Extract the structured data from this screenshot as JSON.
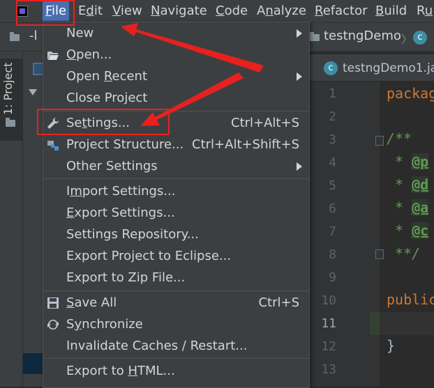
{
  "menubar": {
    "items": [
      {
        "label": "File",
        "pre": "",
        "mn": "F",
        "post": "ile",
        "active": true
      },
      {
        "label": "Edit",
        "pre": "E",
        "mn": "d",
        "post": "it"
      },
      {
        "label": "View",
        "pre": "",
        "mn": "V",
        "post": "iew"
      },
      {
        "label": "Navigate",
        "pre": "",
        "mn": "N",
        "post": "avigate"
      },
      {
        "label": "Code",
        "pre": "",
        "mn": "C",
        "post": "ode"
      },
      {
        "label": "Analyze",
        "pre": "A",
        "mn": "n",
        "post": "alyze"
      },
      {
        "label": "Refactor",
        "pre": "",
        "mn": "R",
        "post": "efactor"
      },
      {
        "label": "Build",
        "pre": "",
        "mn": "B",
        "post": "uild"
      },
      {
        "label": "Ru",
        "pre": "R",
        "mn": "u",
        "post": ""
      }
    ]
  },
  "toolbar": {
    "project_stub": "-l",
    "breadcrumb": "testngDemo",
    "breadcrumb_icon_letter": "c"
  },
  "side_panel": {
    "tab_label": "1: Project"
  },
  "editor": {
    "tab_label": "testngDemo1.ja",
    "tab_icon_letter": "c",
    "line_numbers": [
      "1",
      "2",
      "3",
      "4",
      "5",
      "6",
      "7",
      "8",
      "9",
      "10",
      "11",
      "12",
      "13"
    ],
    "current_line": "11",
    "code": {
      "l1": "packag",
      "l3": "/**",
      "l4_star": " * ",
      "l4_tag": "@p",
      "l5_star": " * ",
      "l5_tag": "@d",
      "l6_star": " * ",
      "l6_tag": "@a",
      "l7_star": " * ",
      "l7_tag": "@c",
      "l8": " **/",
      "l10": "public",
      "l12": "}"
    }
  },
  "file_menu": {
    "items": [
      {
        "key": "new",
        "pre": "New",
        "mn": "",
        "post": "",
        "shortcut": "",
        "submenu": true,
        "icon": ""
      },
      {
        "key": "open",
        "pre": "",
        "mn": "O",
        "post": "pen...",
        "shortcut": "",
        "submenu": false,
        "icon": "folder-open-icon"
      },
      {
        "key": "open_recent",
        "pre": "Open ",
        "mn": "R",
        "post": "ecent",
        "shortcut": "",
        "submenu": true,
        "icon": ""
      },
      {
        "key": "close_project",
        "pre": "Close Pro",
        "mn": "j",
        "post": "ect",
        "shortcut": "",
        "submenu": false,
        "icon": ""
      },
      {
        "key": "settings",
        "pre": "Se",
        "mn": "t",
        "post": "tings...",
        "shortcut": "Ctrl+Alt+S",
        "submenu": false,
        "icon": "wrench-icon"
      },
      {
        "key": "project_structure",
        "pre": "Project Structure...",
        "mn": "",
        "post": "",
        "shortcut": "Ctrl+Alt+Shift+S",
        "submenu": false,
        "icon": "project-structure-icon"
      },
      {
        "key": "other_settings",
        "pre": "Other Settings",
        "mn": "",
        "post": "",
        "shortcut": "",
        "submenu": true,
        "icon": ""
      },
      {
        "key": "import_settings",
        "pre": "I",
        "mn": "m",
        "post": "port Settings...",
        "shortcut": "",
        "submenu": false,
        "icon": ""
      },
      {
        "key": "export_settings",
        "pre": "",
        "mn": "E",
        "post": "xport Settings...",
        "shortcut": "",
        "submenu": false,
        "icon": ""
      },
      {
        "key": "settings_repository",
        "pre": "Settings Repository...",
        "mn": "",
        "post": "",
        "shortcut": "",
        "submenu": false,
        "icon": ""
      },
      {
        "key": "export_eclipse",
        "pre": "Export Project to Eclipse...",
        "mn": "",
        "post": "",
        "shortcut": "",
        "submenu": false,
        "icon": ""
      },
      {
        "key": "export_zip",
        "pre": "Export to Zip File...",
        "mn": "",
        "post": "",
        "shortcut": "",
        "submenu": false,
        "icon": ""
      },
      {
        "key": "save_all",
        "pre": "",
        "mn": "S",
        "post": "ave All",
        "shortcut": "Ctrl+S",
        "submenu": false,
        "icon": "save-icon"
      },
      {
        "key": "synchronize",
        "pre": "S",
        "mn": "y",
        "post": "nchronize",
        "shortcut": "",
        "submenu": false,
        "icon": "sync-icon"
      },
      {
        "key": "invalidate_caches",
        "pre": "Invalidate Caches / Restart...",
        "mn": "",
        "post": "",
        "shortcut": "",
        "submenu": false,
        "icon": ""
      },
      {
        "key": "export_html",
        "pre": "Export to ",
        "mn": "H",
        "post": "TML...",
        "shortcut": "",
        "submenu": false,
        "icon": ""
      }
    ]
  },
  "colors": {
    "menubar_bg": "#3c3f41",
    "active_menu": "#4b6eaf",
    "annotation_red": "#e8211f",
    "editor_bg": "#2b2b2b",
    "keyword": "#cc7832",
    "doc_comment": "#629755"
  }
}
